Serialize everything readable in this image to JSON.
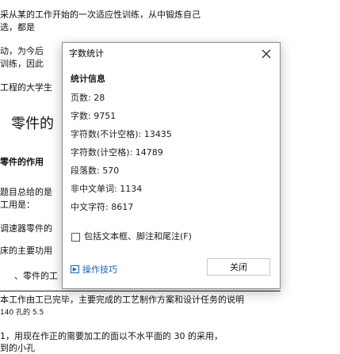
{
  "document": {
    "lines": [
      "采从某的工作开始的一次适应性训练，从中锻炼自己",
      "选，都是",
      "动，为今后",
      "训练，因此",
      "工程的大学生",
      "零件的",
      "零件的作用",
      "题目总给的是",
      "工用是：",
      "调速器零件的",
      "床的主要功用",
      "、零件的工",
      "本工作由工已完毕，主要完成的工艺制作方案和设计任务的说明",
      "140 孔的 5.5",
      "1，用现在作正的需要加工的面以不水平面的 30 的采用，",
      "到的小孔"
    ]
  },
  "dialog": {
    "title": "字数统计",
    "stats_heading": "统计信息",
    "stats": [
      {
        "label": "页数:",
        "value": "28"
      },
      {
        "label": "字数:",
        "value": "9751"
      },
      {
        "label": "字符数(不计空格):",
        "value": "13435"
      },
      {
        "label": "字符数(计空格):",
        "value": "14789"
      },
      {
        "label": "段落数:",
        "value": "570"
      },
      {
        "label": "非中文单词:",
        "value": "1134"
      },
      {
        "label": "中文字符:",
        "value": "8617"
      }
    ],
    "include_checkbox_label": "包括文本框、脚注和尾注(F)",
    "include_checked": false,
    "tips_label": "操作技巧",
    "close_button_label": "关闭"
  }
}
